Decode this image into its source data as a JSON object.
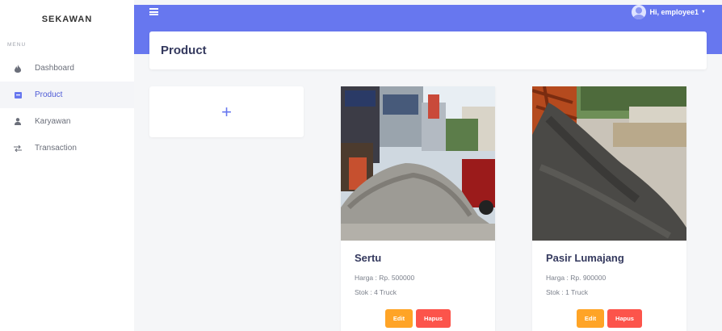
{
  "brand": "SEKAWAN",
  "menu_label": "MENU",
  "nav": [
    {
      "label": "Dashboard",
      "icon": "fire-icon"
    },
    {
      "label": "Product",
      "icon": "product-icon"
    },
    {
      "label": "Karyawan",
      "icon": "user-icon"
    },
    {
      "label": "Transaction",
      "icon": "exchange-icon"
    }
  ],
  "topbar": {
    "user": "Hi, employee1"
  },
  "page": {
    "title": "Product",
    "add_symbol": "+"
  },
  "products": [
    {
      "name": "Sertu",
      "price": "Harga : Rp. 500000",
      "stock": "Stok : 4 Truck",
      "edit": "Edit",
      "delete": "Hapus"
    },
    {
      "name": "Pasir Lumajang",
      "price": "Harga : Rp. 900000",
      "stock": "Stok : 1 Truck",
      "edit": "Edit",
      "delete": "Hapus"
    }
  ],
  "colors": {
    "primary": "#6777ef",
    "edit": "#ffa426",
    "delete": "#fc544b"
  }
}
